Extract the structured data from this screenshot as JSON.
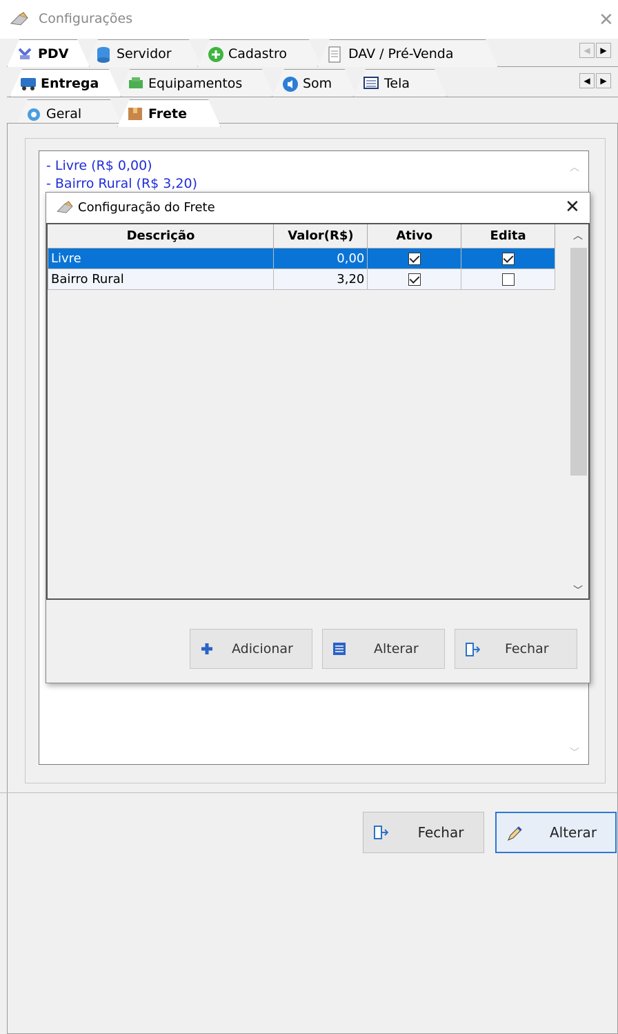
{
  "window": {
    "title": "Configurações"
  },
  "tabs_level1": [
    {
      "label": "PDV",
      "active": true
    },
    {
      "label": "Servidor",
      "active": false
    },
    {
      "label": "Cadastro",
      "active": false
    },
    {
      "label": "DAV / Pré-Venda",
      "active": false
    }
  ],
  "tabs_level2": [
    {
      "label": "Entrega",
      "active": true
    },
    {
      "label": "Equipamentos",
      "active": false
    },
    {
      "label": "Som",
      "active": false
    },
    {
      "label": "Tela",
      "active": false
    }
  ],
  "tabs_level3": [
    {
      "label": "Geral",
      "active": false
    },
    {
      "label": "Frete",
      "active": true
    }
  ],
  "memo": {
    "lines": [
      "- Livre (R$ 0,00)",
      "- Bairro Rural (R$ 3,20)"
    ]
  },
  "dialog": {
    "title": "Configuração do Frete",
    "columns": [
      "Descrição",
      "Valor(R$)",
      "Ativo",
      "Edita"
    ],
    "rows": [
      {
        "descricao": "Livre",
        "valor": "0,00",
        "ativo": true,
        "edita": true,
        "selected": true
      },
      {
        "descricao": "Bairro Rural",
        "valor": "3,20",
        "ativo": true,
        "edita": false,
        "selected": false
      }
    ],
    "buttons": {
      "add": "Adicionar",
      "edit": "Alterar",
      "close": "Fechar"
    }
  },
  "footer": {
    "close": "Fechar",
    "save": "Alterar"
  },
  "colors": {
    "selection": "#0a74d6",
    "memo_text": "#1f2dd8"
  }
}
